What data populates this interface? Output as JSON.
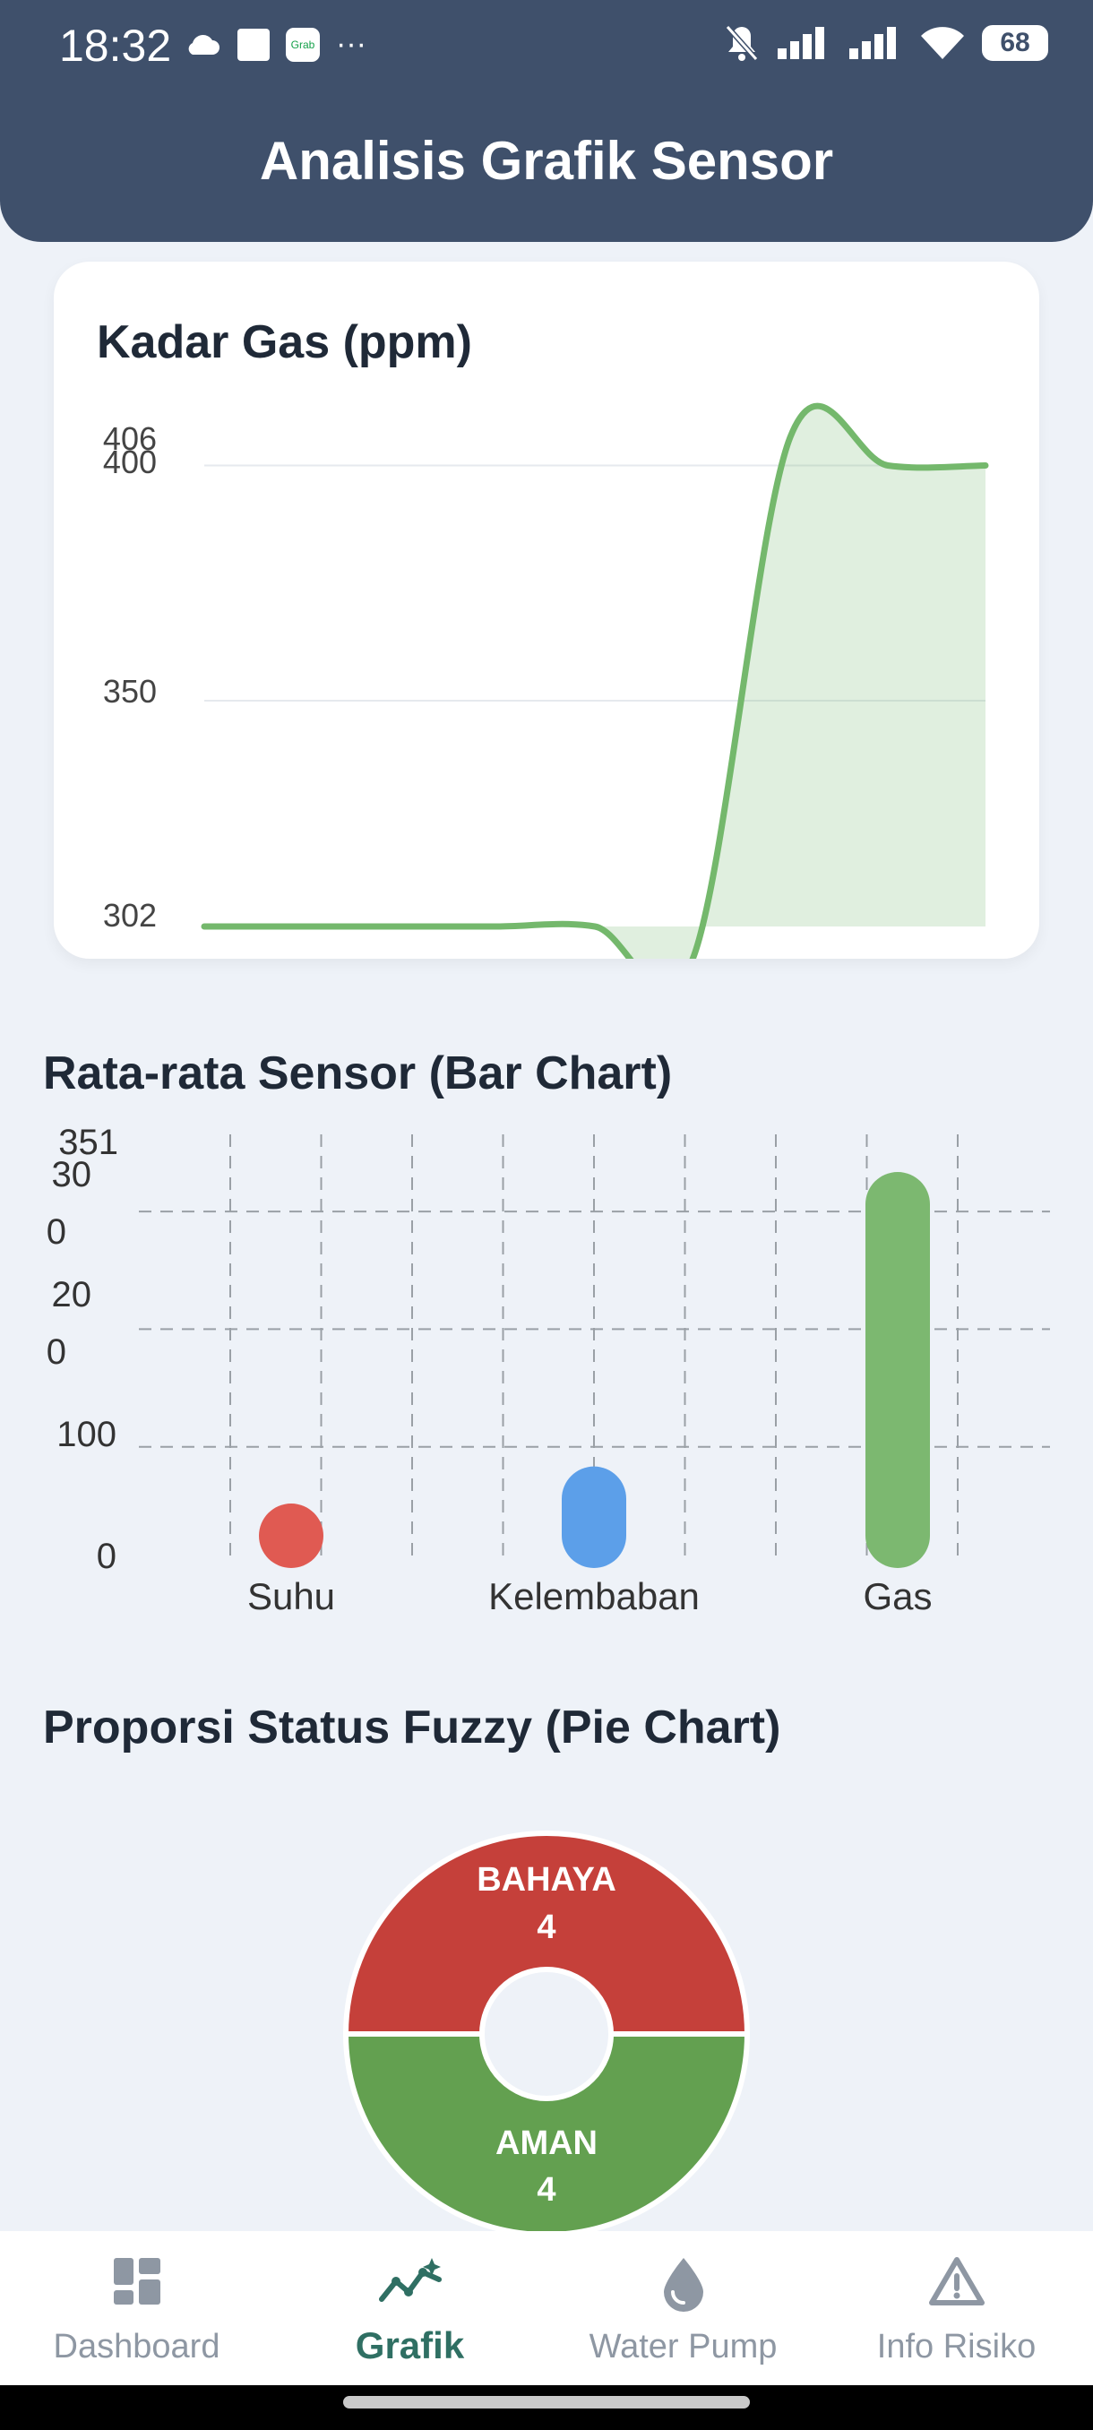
{
  "status_bar": {
    "time": "18:32",
    "more": "···",
    "grab_label": "Grab",
    "battery": "68"
  },
  "header": {
    "title": "Analisis Grafik Sensor"
  },
  "gas_chart": {
    "title": "Kadar Gas (ppm)",
    "y_ticks": [
      "406",
      "400",
      "350",
      "302"
    ],
    "chart_data": {
      "type": "area",
      "title": "Kadar Gas (ppm)",
      "x": [
        0,
        1,
        2,
        3,
        4,
        5,
        6,
        7,
        8
      ],
      "y": [
        302,
        302,
        302,
        302,
        302,
        295,
        406,
        400,
        400
      ],
      "ylim": [
        302,
        406
      ],
      "grid": true,
      "color": "#74b86c"
    }
  },
  "bar_chart": {
    "title": "Rata-rata Sensor (Bar Chart)",
    "y_ticks": [
      "351",
      "30",
      "0",
      "20",
      "0",
      "100",
      "0"
    ],
    "chart_data": {
      "type": "bar",
      "title": "Rata-rata Sensor (Bar Chart)",
      "categories": [
        "Suhu",
        "Kelembaban",
        "Gas"
      ],
      "values": [
        28,
        90,
        351
      ],
      "ylim": [
        0,
        351
      ],
      "colors": [
        "#e05a52",
        "#5c9fe9",
        "#7cb870"
      ],
      "grid": true
    }
  },
  "pie_chart": {
    "title": "Proporsi Status Fuzzy (Pie Chart)",
    "chart_data": {
      "type": "pie",
      "title": "Proporsi Status Fuzzy (Pie Chart)",
      "labels": [
        "BAHAYA",
        "AMAN"
      ],
      "values": [
        4,
        4
      ],
      "colors": [
        "#c5403a",
        "#63a050"
      ]
    },
    "slice_labels": [
      {
        "name": "BAHAYA",
        "count": "4"
      },
      {
        "name": "AMAN",
        "count": "4"
      }
    ]
  },
  "nav": {
    "items": [
      {
        "label": "Dashboard",
        "icon": "dashboard-icon"
      },
      {
        "label": "Grafik",
        "icon": "chart-icon"
      },
      {
        "label": "Water Pump",
        "icon": "water-drop-icon"
      },
      {
        "label": "Info Risiko",
        "icon": "warning-icon"
      }
    ],
    "active": "Grafik"
  }
}
